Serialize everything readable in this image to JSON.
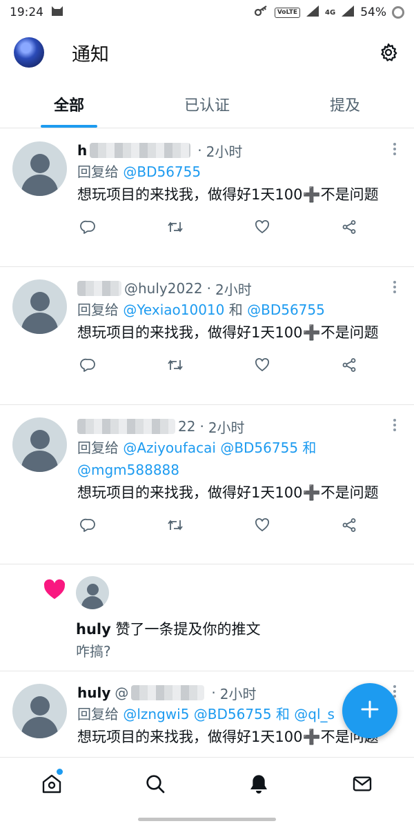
{
  "status_bar": {
    "time": "19:24",
    "volte": "VoLTE",
    "network": "4G",
    "battery": "54%"
  },
  "header": {
    "title": "通知"
  },
  "tabs": [
    {
      "label": "全部",
      "active": true
    },
    {
      "label": "已认证",
      "active": false
    },
    {
      "label": "提及",
      "active": false
    }
  ],
  "notifications": [
    {
      "type": "reply",
      "name_visible": "h",
      "handle_visible": "",
      "time": "2小时",
      "reply_prefix": "回复给",
      "mentions": [
        "@BD56755"
      ],
      "text": "想玩项目的来找我，做得好1天100➕不是问题"
    },
    {
      "type": "reply",
      "name_visible": "",
      "handle_visible": "@huly2022",
      "time": "2小时",
      "reply_prefix": "回复给",
      "mentions": [
        "@Yexiao10010",
        "和",
        "@BD56755"
      ],
      "text": "想玩项目的来找我，做得好1天100➕不是问题"
    },
    {
      "type": "reply",
      "name_visible": "",
      "handle_visible": "22",
      "time": "2小时",
      "reply_prefix": "回复给",
      "mentions": [
        "@Aziyoufacai",
        "@BD56755",
        "和",
        "@mgm588888"
      ],
      "text": "想玩项目的来找我，做得好1天100➕不是问题"
    },
    {
      "type": "like",
      "user": "huly",
      "action": "赞了一条提及你的推文",
      "snippet": "咋搞?"
    },
    {
      "type": "reply",
      "name_visible": "huly",
      "handle_visible": "@",
      "time": "2小时",
      "reply_prefix": "回复给",
      "mentions": [
        "@lzngwi5",
        "@BD56755",
        "和",
        "@ql_s"
      ],
      "text": "想玩项目的来找我，做得好1天100➕不是问题"
    }
  ],
  "colors": {
    "accent": "#1d9bf0",
    "like": "#f91880",
    "secondary_text": "#536471"
  },
  "icons": {
    "reply": "reply-icon",
    "retweet": "retweet-icon",
    "like": "like-icon",
    "share": "share-icon",
    "more": "more-icon",
    "settings": "gear-icon",
    "compose": "plus-icon",
    "nav": [
      "home-icon",
      "search-icon",
      "bell-icon",
      "mail-icon"
    ]
  }
}
